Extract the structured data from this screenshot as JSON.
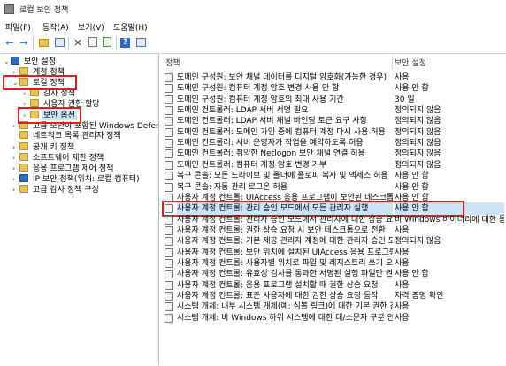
{
  "window": {
    "title": "로컬 보안 정책"
  },
  "menu": [
    "파일(F)",
    "동작(A)",
    "보기(V)",
    "도움말(H)"
  ],
  "toolbar": {
    "icons": [
      "back-icon",
      "forward-icon",
      "up-folder-icon",
      "show-hide-tree-icon",
      "delete-icon",
      "properties-icon",
      "export-list-icon",
      "help-icon",
      "details-view-icon"
    ]
  },
  "tree": [
    {
      "label": "보안 설정",
      "level": 0,
      "expander": "v",
      "icon": "shield"
    },
    {
      "label": "계정 정책",
      "level": 1,
      "expander": ">",
      "icon": "folder"
    },
    {
      "label": "로컬 정책",
      "level": 1,
      "expander": "v",
      "icon": "folder"
    },
    {
      "label": "감사 정책",
      "level": 2,
      "expander": ">",
      "icon": "folder"
    },
    {
      "label": "사용자 권한 할당",
      "level": 2,
      "expander": ">",
      "icon": "folder"
    },
    {
      "label": "보안 옵션",
      "level": 2,
      "expander": ">",
      "icon": "folder",
      "selected": true
    },
    {
      "label": "고급 보안이 포함된 Windows Defender 방화벽",
      "level": 1,
      "expander": ">",
      "icon": "folder"
    },
    {
      "label": "네트워크 목록 관리자 정책",
      "level": 1,
      "expander": "",
      "icon": "folder"
    },
    {
      "label": "공개 키 정책",
      "level": 1,
      "expander": ">",
      "icon": "folder"
    },
    {
      "label": "소프트웨어 제한 정책",
      "level": 1,
      "expander": ">",
      "icon": "folder"
    },
    {
      "label": "응용 프로그램 제어 정책",
      "level": 1,
      "expander": ">",
      "icon": "folder"
    },
    {
      "label": "IP 보안 정책(위치: 로컬 컴퓨터)",
      "level": 1,
      "expander": ">",
      "icon": "shield"
    },
    {
      "label": "고급 감사 정책 구성",
      "level": 1,
      "expander": ">",
      "icon": "folder"
    }
  ],
  "columns": {
    "policy": "정책",
    "setting": "보안 설정"
  },
  "policies": [
    {
      "name": "도메인 구성원: 보안 채널 데이터를 디지털 암호화(가능한 경우)",
      "value": "사용"
    },
    {
      "name": "도메인 구성원: 컴퓨터 계정 암호 변경 사용 안 함",
      "value": "사용 안 함"
    },
    {
      "name": "도메인 구성원: 컴퓨터 계정 암호의 최대 사용 기간",
      "value": "30 일"
    },
    {
      "name": "도메인 컨트롤러: LDAP 서버 서명 필요",
      "value": "정의되지 않음"
    },
    {
      "name": "도메인 컨트롤러: LDAP 서버 채널 바인딩 토큰 요구 사항",
      "value": "정의되지 않음"
    },
    {
      "name": "도메인 컨트롤러: 도메인 가입 중에 컴퓨터 계정 다시 사용 허용",
      "value": "정의되지 않음"
    },
    {
      "name": "도메인 컨트롤러: 서버 운영자가 작업을 예약하도록 허용",
      "value": "정의되지 않음"
    },
    {
      "name": "도메인 컨트롤러: 취약한 Netlogon 보안 채널 연결 허용",
      "value": "정의되지 않음"
    },
    {
      "name": "도메인 컨트롤러: 컴퓨터 계정 암호 변경 거부",
      "value": "정의되지 않음"
    },
    {
      "name": "복구 콘솔: 모든 드라이브 및 폴더에 플로피 복사 및 액세스 허용",
      "value": "사용 안 함"
    },
    {
      "name": "복구 콘솔: 자동 관리 로그온 허용",
      "value": "사용 안 함"
    },
    {
      "name": "사용자 계정 컨트롤: UIAccess 응용 프로그램이 보안된 데스크톱을 사용하지 않고 상승 요청 메시지를 표시하도록 허용",
      "value": "사용 안 함"
    },
    {
      "name": "사용자 계정 컨트롤: 관리 승인 모드에서 모든 관리자 실행",
      "value": "사용 안 함",
      "selected": true
    },
    {
      "name": "사용자 계정 컨트롤: 관리자 승인 모드에서 관리자에 대한 상승 요청 동작",
      "value": "비 Windows 바이너리에 대한 동의 확인"
    },
    {
      "name": "사용자 계정 컨트롤: 권한 상승 요청 시 보안 데스크톱으로 전환",
      "value": "사용"
    },
    {
      "name": "사용자 계정 컨트롤: 기본 제공 관리자 계정에 대한 관리자 승인 모드",
      "value": "정의되지 않음"
    },
    {
      "name": "사용자 계정 컨트롤: 보안 위치에 설치된 UIAccess 응용 프로그램만 권한 상승",
      "value": "사용"
    },
    {
      "name": "사용자 계정 컨트롤: 사용자별 위치로 파일 및 레지스트리 쓰기 오류 가상화",
      "value": "사용"
    },
    {
      "name": "사용자 계정 컨트롤: 유효성 검사를 통과한 서명된 실행 파일만 권한 상승",
      "value": "사용 안 함"
    },
    {
      "name": "사용자 계정 컨트롤: 응용 프로그램 설치할 때 권한 상승 요청",
      "value": "사용"
    },
    {
      "name": "사용자 계정 컨트롤: 표준 사용자에 대한 권한 상승 요청 동작",
      "value": "자격 증명 확인"
    },
    {
      "name": "시스템 개체: 내부 시스템 개체(예: 심볼 링크)에 대한 기본 권한 강화",
      "value": "사용"
    },
    {
      "name": "시스템 개체: 비 Windows 하위 시스템에 대한 대/소문자 구분 안 함 필요",
      "value": "사용"
    }
  ]
}
